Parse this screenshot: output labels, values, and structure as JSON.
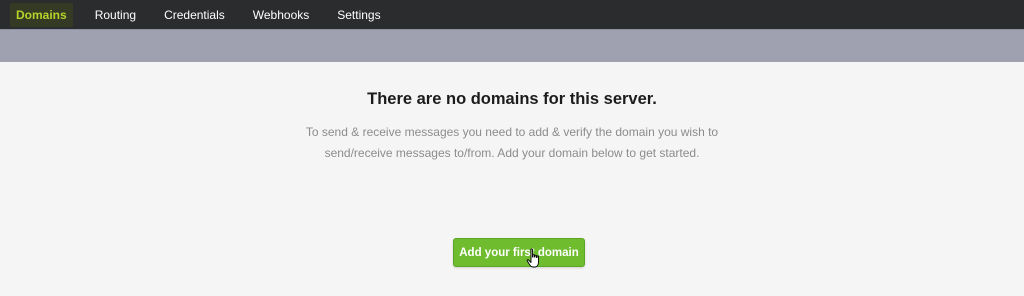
{
  "nav": {
    "items": [
      {
        "label": "Domains",
        "active": true
      },
      {
        "label": "Routing"
      },
      {
        "label": "Credentials"
      },
      {
        "label": "Webhooks"
      },
      {
        "label": "Settings"
      }
    ]
  },
  "empty_state": {
    "title": "There are no domains for this server.",
    "description_line1": "To send & receive messages you need to add & verify the domain you wish to",
    "description_line2": "send/receive messages to/from. Add your domain below to get started.",
    "button_label": "Add your first domain"
  },
  "colors": {
    "nav_bg": "#2b2c2e",
    "nav_active_text": "#b7d22b",
    "subbar_bg": "#a0a1b0",
    "content_bg": "#f5f5f5",
    "button_bg": "#6fbd2f"
  },
  "icons": {
    "cursor": "hand-pointer-icon"
  }
}
